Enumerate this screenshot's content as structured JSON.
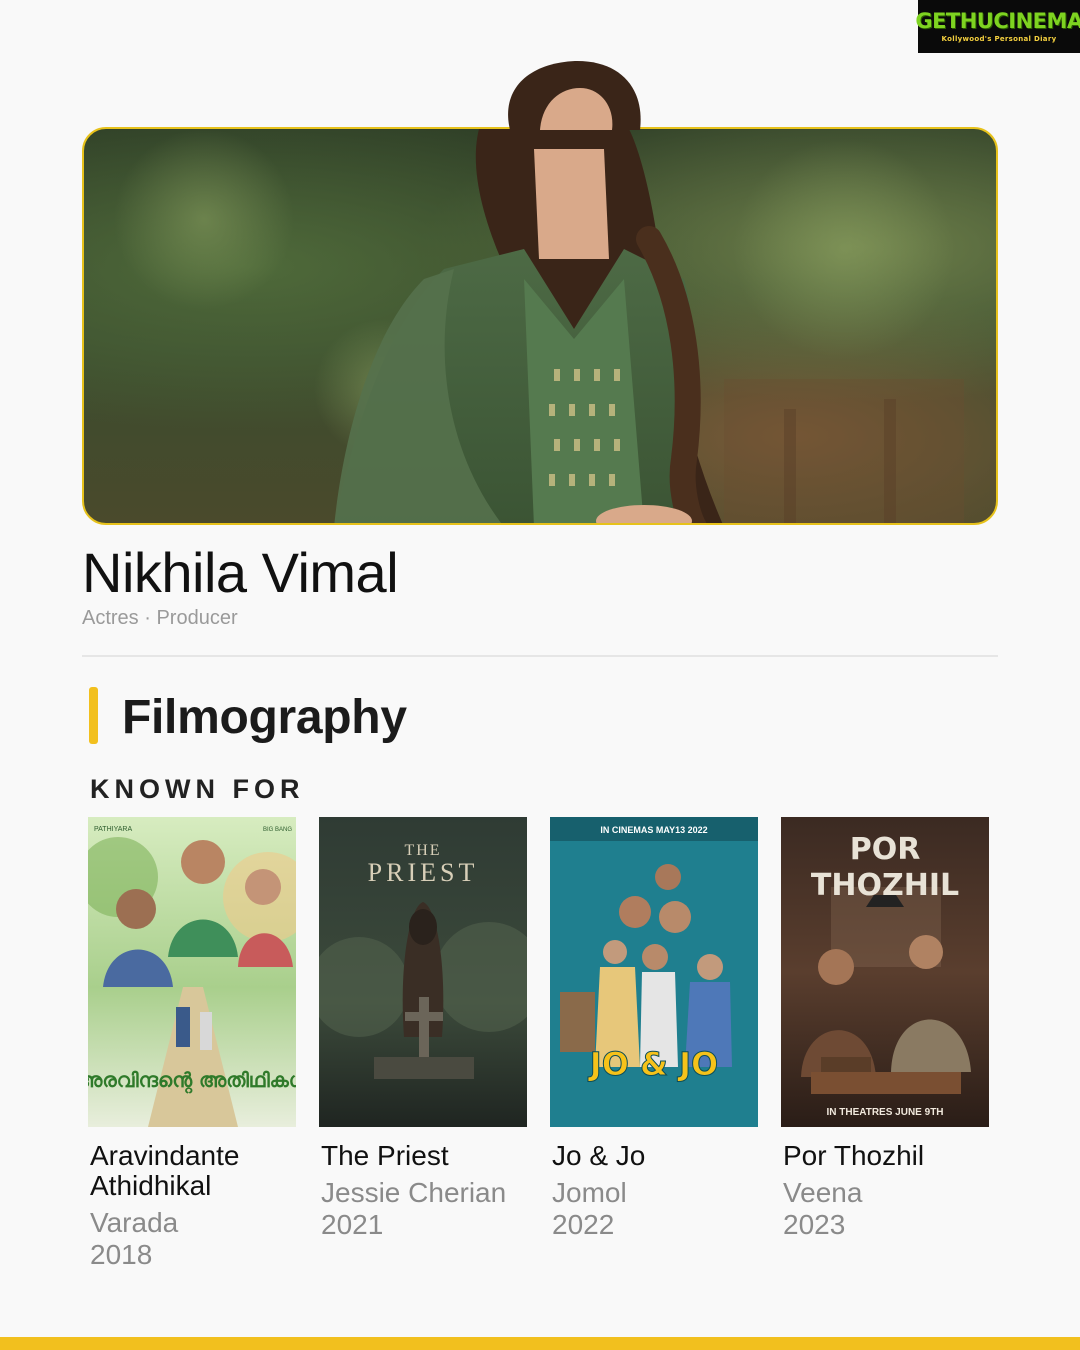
{
  "logo": {
    "brand": "GETHUCINEMA",
    "tagline": "Kollywood's Personal Diary"
  },
  "profile": {
    "name": "Nikhila Vimal",
    "roles": "Actres · Producer"
  },
  "section": {
    "title": "Filmography",
    "subtitle": "KNOWN FOR"
  },
  "films": [
    {
      "title": "Aravindante Athidhikal",
      "role": "Varada",
      "year": "2018",
      "poster": {
        "top_left": "PATHIYARA",
        "top_right": "BIG BANG",
        "logo_text": "അരവിന്ദന്റെ അതിഥികൾ"
      }
    },
    {
      "title": "The Priest",
      "role": "Jessie Cherian",
      "year": "2021",
      "poster": {
        "line1": "THE",
        "line2": "PRIEST"
      }
    },
    {
      "title": "Jo & Jo",
      "role": "Jomol",
      "year": "2022",
      "poster": {
        "banner": "IN CINEMAS MAY13 2022",
        "logo_text": "JO & JO"
      }
    },
    {
      "title": "Por Thozhil",
      "role": "Veena",
      "year": "2023",
      "poster": {
        "line1": "POR",
        "line2": "THOZHIL",
        "footer": "IN THEATRES JUNE 9TH"
      }
    }
  ],
  "colors": {
    "accent": "#f2c01e",
    "hero_border": "#e7c21b",
    "muted_text": "#8a8a8a",
    "background": "#f9f9f9"
  }
}
